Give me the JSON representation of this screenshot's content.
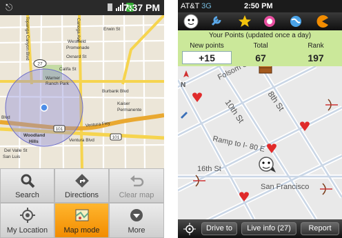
{
  "left_phone": {
    "status_time": "7:37 PM",
    "map_labels": {
      "westfield": "Westfield",
      "promenade": "Promenade",
      "oxnard": "Oxnard St",
      "erwin": "Erwin St",
      "calif": "Califa St",
      "warner": "Warner",
      "ranch_park": "Ranch Park",
      "burbank": "Burbank Blvd",
      "kaiser": "Kaiser",
      "permanente": "Permanente",
      "ventura_fwy": "Ventura Fwy",
      "ventura_blvd": "Ventura Blvd",
      "woodland": "Woodland",
      "hills": "Hills",
      "del_valle": "Del Valle St",
      "san_luis": "San Luis",
      "canoga": "Canoga Ave",
      "topanga": "Topanga Canyon Blvd",
      "blvd": "Blvd",
      "shield_27": "27",
      "shield_101": "101",
      "shield_101b": "101"
    },
    "menu": [
      {
        "label": "Search",
        "icon": "search-icon"
      },
      {
        "label": "Directions",
        "icon": "directions-icon"
      },
      {
        "label": "Clear map",
        "icon": "undo-icon"
      },
      {
        "label": "My Location",
        "icon": "my-location-icon"
      },
      {
        "label": "Map mode",
        "icon": "map-mode-icon"
      },
      {
        "label": "More",
        "icon": "more-icon"
      }
    ]
  },
  "right_phone": {
    "carrier": "AT&T",
    "network": "3G",
    "status_time": "2:50 PM",
    "points_title": "Your Points (updated once a day)",
    "new_points_label": "New points",
    "new_points_value": "+15",
    "total_label": "Total",
    "total_value": "67",
    "rank_label": "Rank",
    "rank_value": "197",
    "compass": "N",
    "map_labels": {
      "folsom": "Folsom St",
      "tenth": "10th St",
      "eighth": "8th St",
      "ramp": "Ramp to I- 80 E",
      "sixteenth": "16th St",
      "sf": "San Francisco"
    },
    "bottom_bar": {
      "drive_to": "Drive to",
      "live_info": "Live info (27)",
      "report": "Report"
    },
    "accent_green": "#cbe89a"
  }
}
